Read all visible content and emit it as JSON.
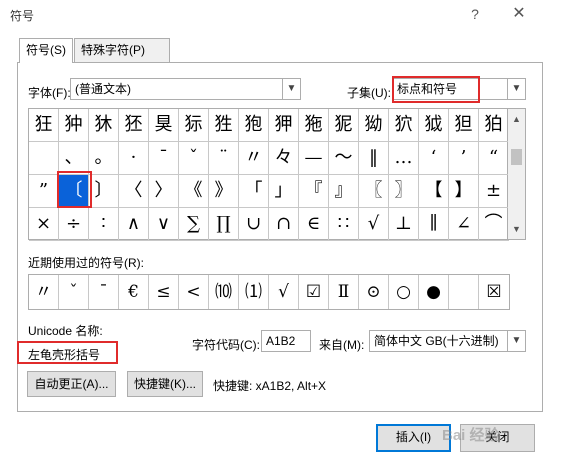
{
  "dialog": {
    "title": "符号",
    "help": "?",
    "close": "✕"
  },
  "tabs": [
    {
      "label": "符号(S)"
    },
    {
      "label": "特殊字符(P)"
    }
  ],
  "font": {
    "label": "字体(F):",
    "value": "(普通文本)"
  },
  "subset": {
    "label": "子集(U):",
    "value": "标点和符号"
  },
  "symbols": [
    [
      "狂",
      "狆",
      "狇",
      "狉",
      "狊",
      "狋",
      "狌",
      "狍",
      "狎",
      "狏",
      "狔",
      "狕",
      "狖",
      "狘",
      "狚",
      "狛"
    ],
    [
      "",
      "、",
      "。",
      "·",
      "ˉ",
      "ˇ",
      "¨",
      "〃",
      "々",
      "—",
      "～",
      "‖",
      "…",
      "‘",
      "’",
      "“"
    ],
    [
      "”",
      "〔",
      "〕",
      "〈",
      "〉",
      "《",
      "》",
      "「",
      "」",
      "『",
      "』",
      "〖",
      "〗",
      "【",
      "】",
      "±"
    ],
    [
      "×",
      "÷",
      "∶",
      "∧",
      "∨",
      "∑",
      "∏",
      "∪",
      "∩",
      "∈",
      "∷",
      "√",
      "⊥",
      "∥",
      "∠",
      "⌒"
    ]
  ],
  "selected": {
    "row": 2,
    "col": 1
  },
  "recent": {
    "label": "近期使用过的符号(R):",
    "items": [
      "〃",
      "ˇ",
      "ˉ",
      "€",
      "≤",
      "<",
      "⑽",
      "⑴",
      "√",
      "☑",
      "Ⅱ",
      "⊙",
      "○",
      "●",
      "",
      "☒"
    ]
  },
  "unicode": {
    "label": "Unicode 名称:",
    "name": "左龟壳形括号"
  },
  "charcode": {
    "label": "字符代码(C):",
    "value": "A1B2"
  },
  "from": {
    "label": "来自(M):",
    "value": "简体中文 GB(十六进制)"
  },
  "buttons": {
    "autocorrect": "自动更正(A)...",
    "shortcut": "快捷键(K)...",
    "insert": "插入(I)",
    "close": "关闭"
  },
  "shortcut_text": "快捷键: xA1B2, Alt+X",
  "watermark": "Bai 经验",
  "colors": {
    "selection": "#0a62d9",
    "highlight": "#e02b2b",
    "default_button": "#0078d7"
  }
}
